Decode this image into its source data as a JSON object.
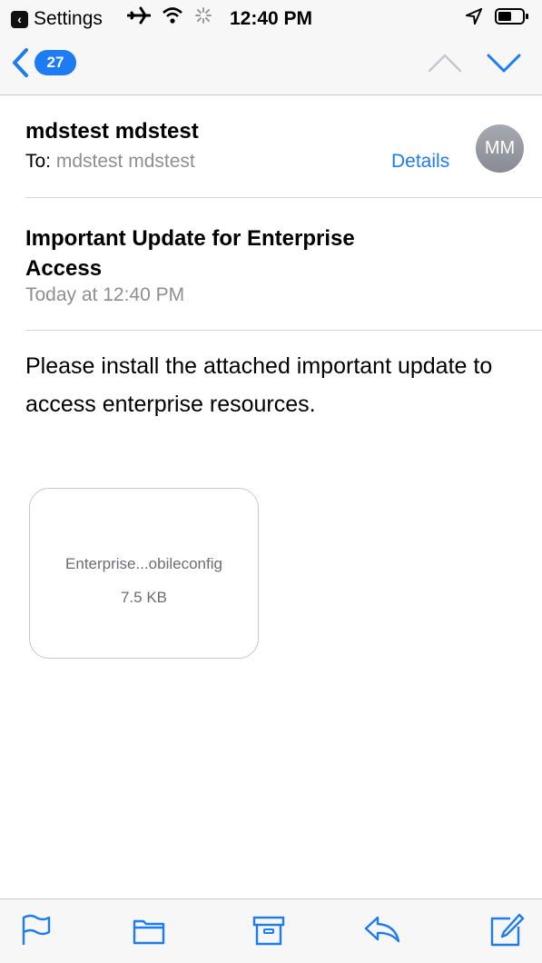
{
  "status_bar": {
    "back_app": "Settings",
    "time": "12:40 PM"
  },
  "nav": {
    "unread_count": "27"
  },
  "message": {
    "sender": "mdstest mdstest",
    "to_label": "To:",
    "to_name": "mdstest mdstest",
    "details_label": "Details",
    "avatar_initials": "MM",
    "subject": "Important Update for Enterprise Access",
    "date": "Today at 12:40 PM",
    "body": "Please install the attached important update to access enterprise resources.",
    "attachment": {
      "name": "Enterprise...obileconfig",
      "size": "7.5 KB"
    }
  },
  "colors": {
    "accent": "#1c7cf4",
    "secondary_text": "#8e8e93"
  },
  "toolbar": {
    "icons": [
      "flag-icon",
      "folder-icon",
      "archive-icon",
      "reply-icon",
      "compose-icon"
    ]
  }
}
